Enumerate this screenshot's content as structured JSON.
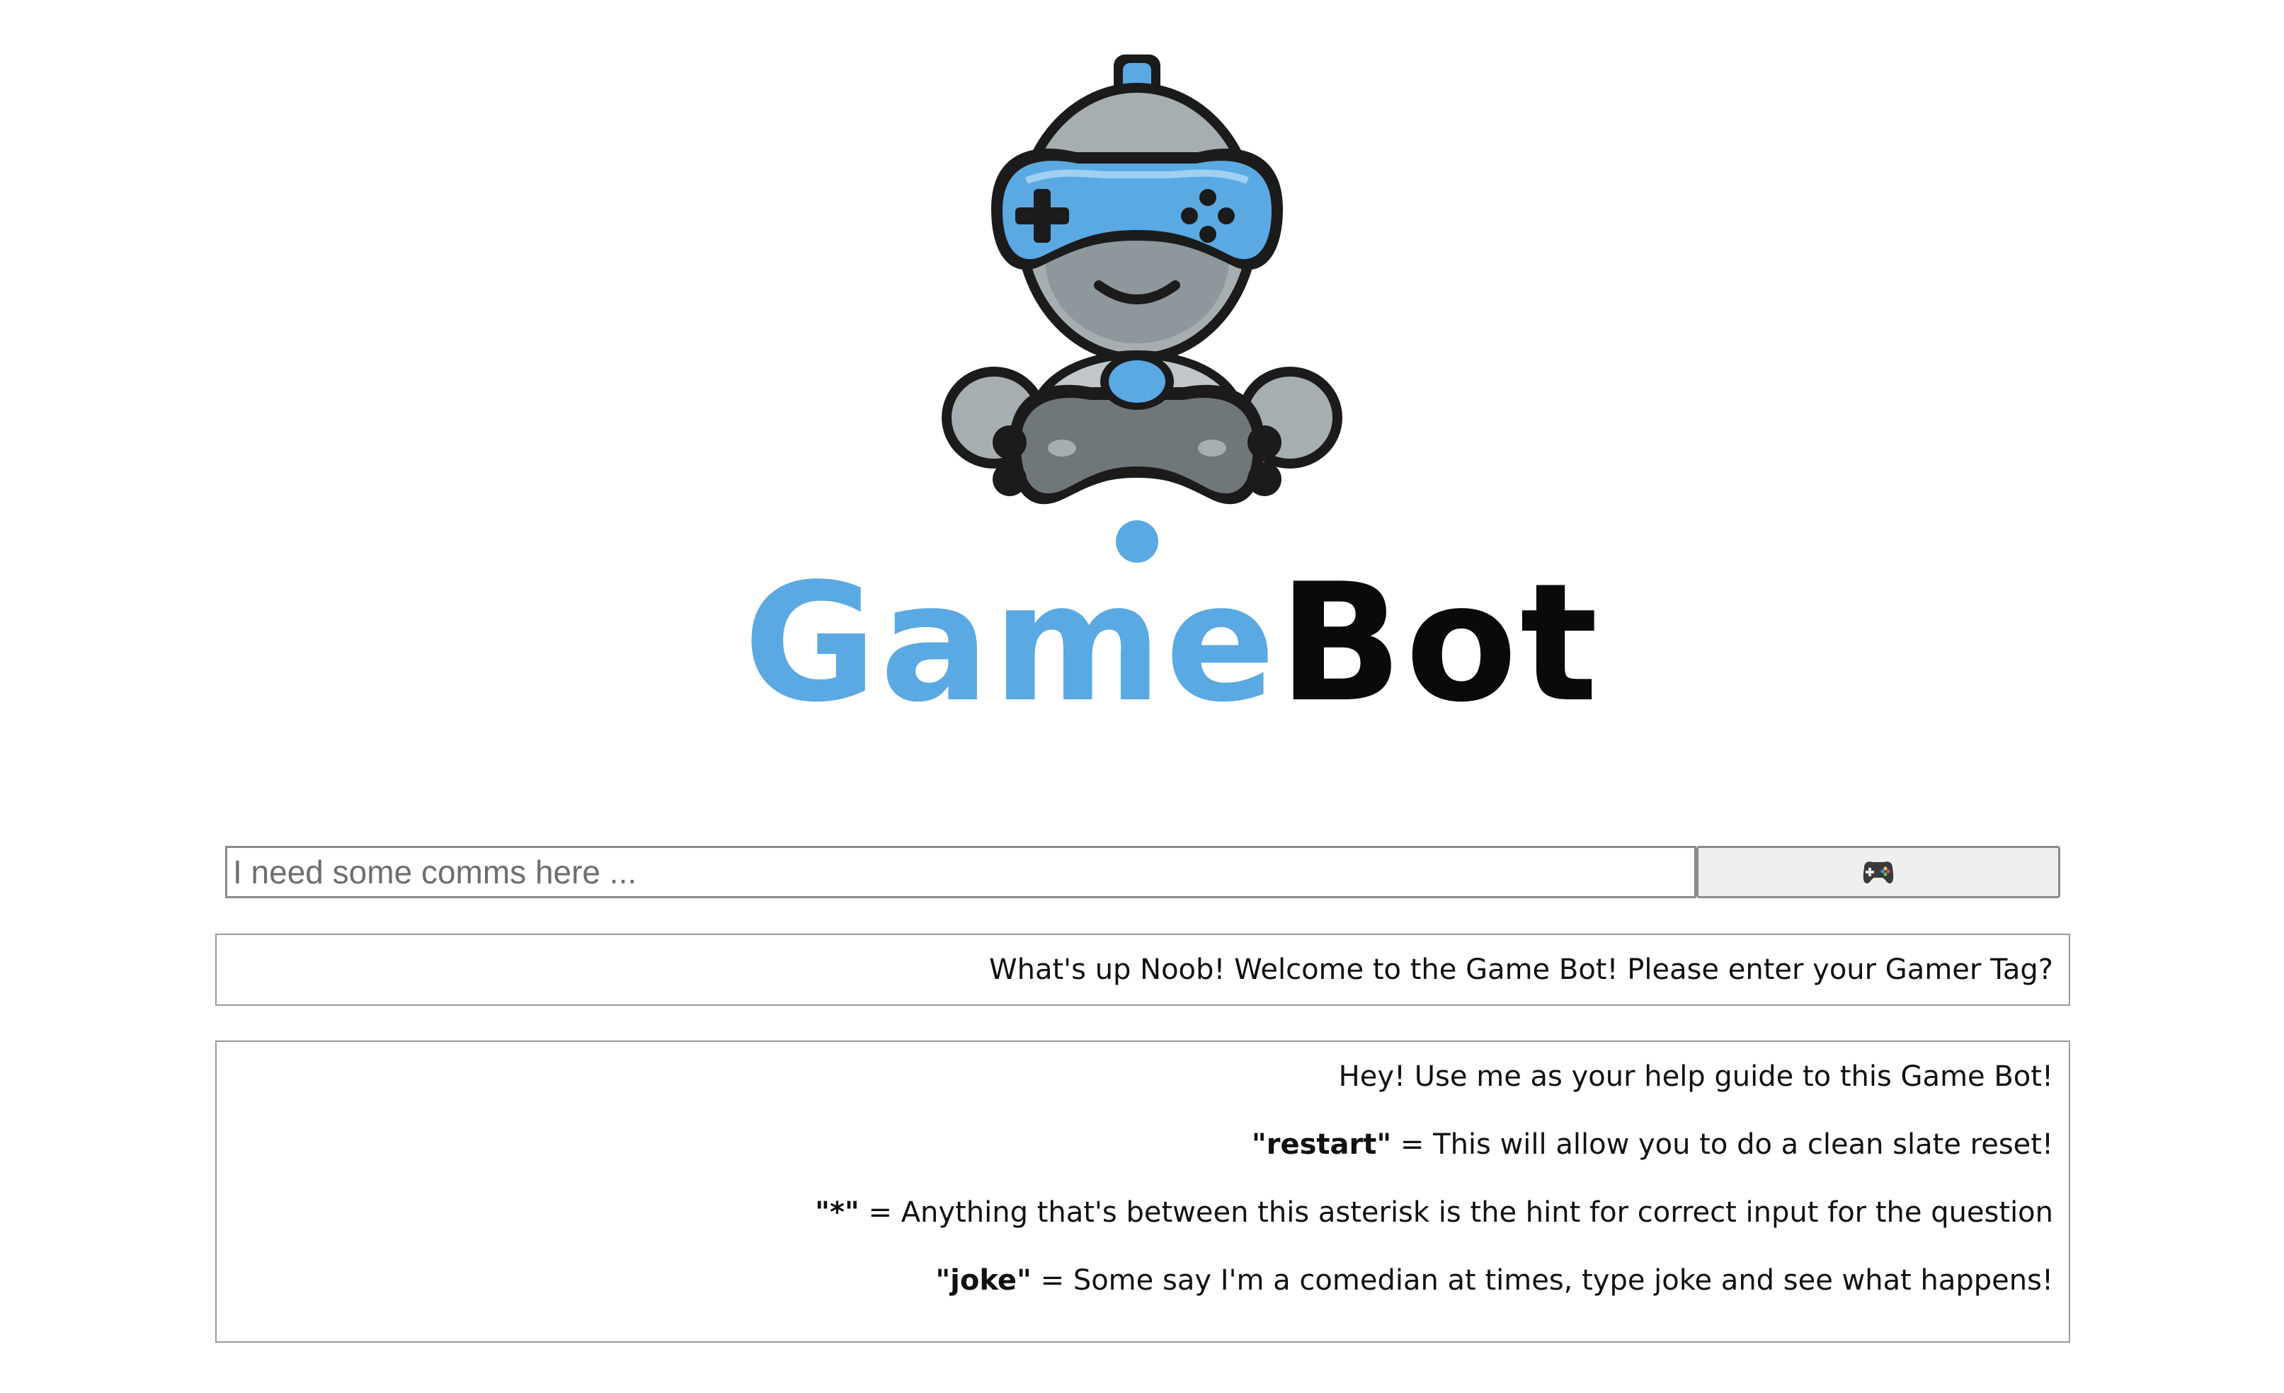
{
  "logo": {
    "word_game": "Game",
    "word_bot": "Bot",
    "colors": {
      "blue": "#5aa9e2",
      "dark": "#0a0a0a",
      "gray": "#8e979c"
    },
    "icon": "robot-gamer-icon"
  },
  "chat": {
    "input_value": "",
    "input_placeholder": "I need some comms here ...",
    "send_icon": "gamepad-icon"
  },
  "bot_message": "What's up Noob! Welcome to the Game Bot! Please enter your Gamer Tag?",
  "help": {
    "intro": "Hey! Use me as your help guide to this Game Bot!",
    "commands": [
      {
        "key": "\"restart\"",
        "description": " = This will allow you to do a clean slate reset!"
      },
      {
        "key": "\"*\"",
        "description": " = Anything that's between this asterisk is the hint for correct input for the question"
      },
      {
        "key": "\"joke\"",
        "description": " = Some say I'm a comedian at times, type joke and see what happens!"
      }
    ]
  }
}
